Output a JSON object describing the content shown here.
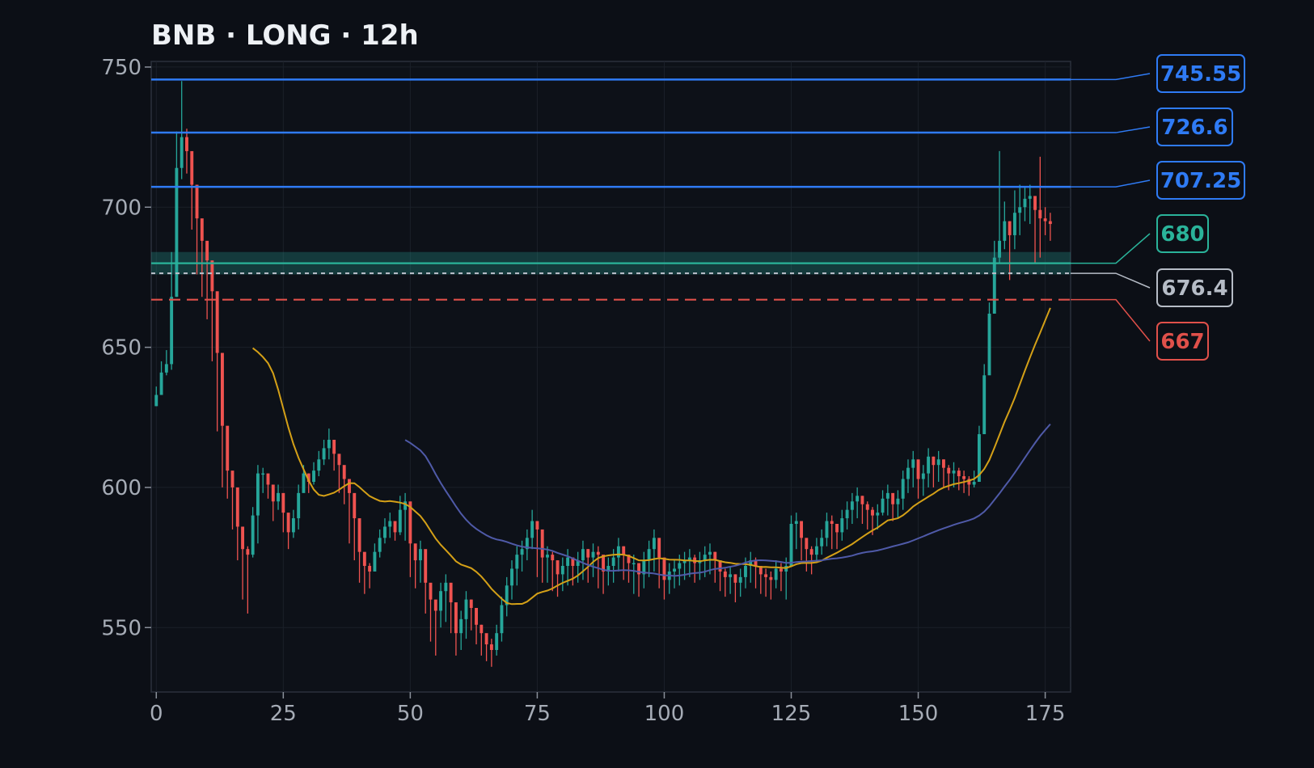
{
  "chart_data": {
    "type": "candlestick",
    "title": "BNB · LONG · 12h",
    "xlim": [
      -1,
      180
    ],
    "ylim": [
      527,
      752
    ],
    "x_ticks": [
      0,
      25,
      50,
      75,
      100,
      125,
      150,
      175
    ],
    "y_ticks": [
      550,
      600,
      650,
      700,
      750
    ],
    "grid": true,
    "colors": {
      "background": "#0c0f16",
      "up": "#26a69a",
      "down": "#ef5350",
      "fast_ma": "#d4a017",
      "slow_ma": "#4f5aa8",
      "target": "#2f7bf5",
      "entry": "#2ab39a",
      "current": "#b6bcc6",
      "stop": "#e0504a"
    },
    "zone": [
      676.0,
      684.0
    ],
    "levels": [
      {
        "label": "745.55",
        "value": 745.55,
        "kind": "target",
        "color": "#2f7bf5"
      },
      {
        "label": "726.6",
        "value": 726.6,
        "kind": "target",
        "color": "#2f7bf5"
      },
      {
        "label": "707.25",
        "value": 707.25,
        "kind": "target",
        "color": "#2f7bf5"
      },
      {
        "label": "680",
        "value": 680,
        "kind": "entry",
        "color": "#2ab39a"
      },
      {
        "label": "676.4",
        "value": 676.4,
        "kind": "current",
        "color": "#b6bcc6"
      },
      {
        "label": "667",
        "value": 667,
        "kind": "stop",
        "color": "#e0504a"
      }
    ],
    "close": [
      633,
      641,
      644,
      668,
      714,
      725,
      720,
      708,
      696,
      688,
      681,
      670,
      648,
      622,
      606,
      600,
      586,
      578,
      576,
      590,
      605,
      605,
      601,
      595,
      598,
      591,
      584,
      589,
      598,
      605,
      602,
      606,
      610,
      614,
      617,
      612,
      608,
      603,
      598,
      589,
      577,
      572,
      570,
      577,
      582,
      586,
      588,
      584,
      592,
      595,
      580,
      574,
      578,
      566,
      560,
      556,
      563,
      566,
      559,
      548,
      553,
      560,
      557,
      551,
      548,
      544,
      542,
      548,
      558,
      565,
      571,
      576,
      578,
      582,
      588,
      585,
      575,
      576,
      574,
      569,
      572,
      575,
      572,
      574,
      578,
      575,
      577,
      576,
      570,
      572,
      575,
      579,
      576,
      573,
      573,
      569,
      574,
      578,
      582,
      575,
      567,
      570,
      571,
      573,
      574,
      575,
      573,
      574,
      576,
      577,
      574,
      570,
      568,
      569,
      566,
      568,
      572,
      574,
      572,
      569,
      568,
      567,
      571,
      570,
      572,
      587,
      588,
      582,
      578,
      576,
      579,
      582,
      588,
      587,
      584,
      589,
      592,
      595,
      597,
      594,
      592,
      590,
      591,
      596,
      598,
      594,
      596,
      603,
      607,
      610,
      603,
      605,
      611,
      608,
      610,
      607,
      605,
      606,
      604,
      603,
      601,
      602,
      619,
      640,
      662,
      682,
      688,
      695,
      690,
      698,
      700,
      703,
      704,
      699,
      696,
      695,
      694
    ],
    "high": [
      636,
      645,
      649,
      684,
      727,
      745,
      728,
      711,
      699,
      690,
      684,
      673,
      651,
      625,
      609,
      605,
      589,
      581,
      579,
      593,
      608,
      607,
      604,
      598,
      601,
      594,
      587,
      592,
      601,
      608,
      605,
      609,
      613,
      617,
      621,
      615,
      611,
      606,
      601,
      592,
      580,
      575,
      573,
      580,
      585,
      589,
      591,
      587,
      597,
      598,
      583,
      577,
      581,
      569,
      563,
      559,
      566,
      569,
      562,
      551,
      556,
      563,
      560,
      554,
      551,
      547,
      546,
      551,
      561,
      568,
      574,
      579,
      581,
      585,
      592,
      588,
      578,
      579,
      577,
      572,
      575,
      578,
      575,
      577,
      581,
      578,
      580,
      579,
      573,
      575,
      578,
      582,
      579,
      576,
      576,
      572,
      577,
      581,
      585,
      578,
      570,
      573,
      574,
      576,
      577,
      578,
      576,
      577,
      579,
      580,
      577,
      573,
      571,
      572,
      569,
      571,
      575,
      577,
      575,
      572,
      571,
      570,
      574,
      573,
      575,
      590,
      591,
      585,
      581,
      579,
      582,
      585,
      591,
      590,
      587,
      592,
      595,
      598,
      600,
      597,
      595,
      593,
      594,
      599,
      601,
      597,
      599,
      606,
      610,
      613,
      606,
      608,
      614,
      611,
      613,
      610,
      608,
      609,
      607,
      606,
      604,
      606,
      622,
      644,
      666,
      688,
      720,
      702,
      695,
      706,
      708,
      707,
      708,
      703,
      718,
      700,
      698
    ],
    "low": [
      629,
      633,
      640,
      642,
      668,
      710,
      712,
      692,
      676,
      668,
      660,
      645,
      620,
      600,
      596,
      585,
      574,
      560,
      555,
      575,
      580,
      598,
      596,
      588,
      592,
      584,
      578,
      582,
      585,
      600,
      598,
      601,
      604,
      608,
      610,
      606,
      598,
      594,
      580,
      574,
      566,
      562,
      564,
      571,
      575,
      580,
      582,
      581,
      583,
      581,
      568,
      564,
      566,
      555,
      545,
      540,
      550,
      552,
      548,
      540,
      542,
      546,
      549,
      544,
      540,
      538,
      536,
      540,
      545,
      554,
      560,
      565,
      570,
      574,
      578,
      568,
      566,
      566,
      563,
      561,
      563,
      565,
      565,
      566,
      567,
      566,
      568,
      564,
      562,
      565,
      566,
      570,
      567,
      566,
      562,
      561,
      564,
      568,
      570,
      564,
      560,
      562,
      564,
      565,
      567,
      568,
      566,
      567,
      568,
      569,
      566,
      563,
      561,
      562,
      559,
      561,
      564,
      566,
      564,
      562,
      561,
      560,
      564,
      563,
      560,
      575,
      578,
      574,
      570,
      569,
      573,
      576,
      579,
      578,
      578,
      581,
      585,
      587,
      589,
      587,
      585,
      583,
      585,
      590,
      590,
      588,
      589,
      592,
      598,
      600,
      596,
      597,
      600,
      600,
      602,
      600,
      599,
      600,
      599,
      598,
      597,
      600,
      605,
      625,
      650,
      670,
      680,
      685,
      674,
      685,
      690,
      695,
      694,
      680,
      682,
      690,
      688
    ]
  }
}
